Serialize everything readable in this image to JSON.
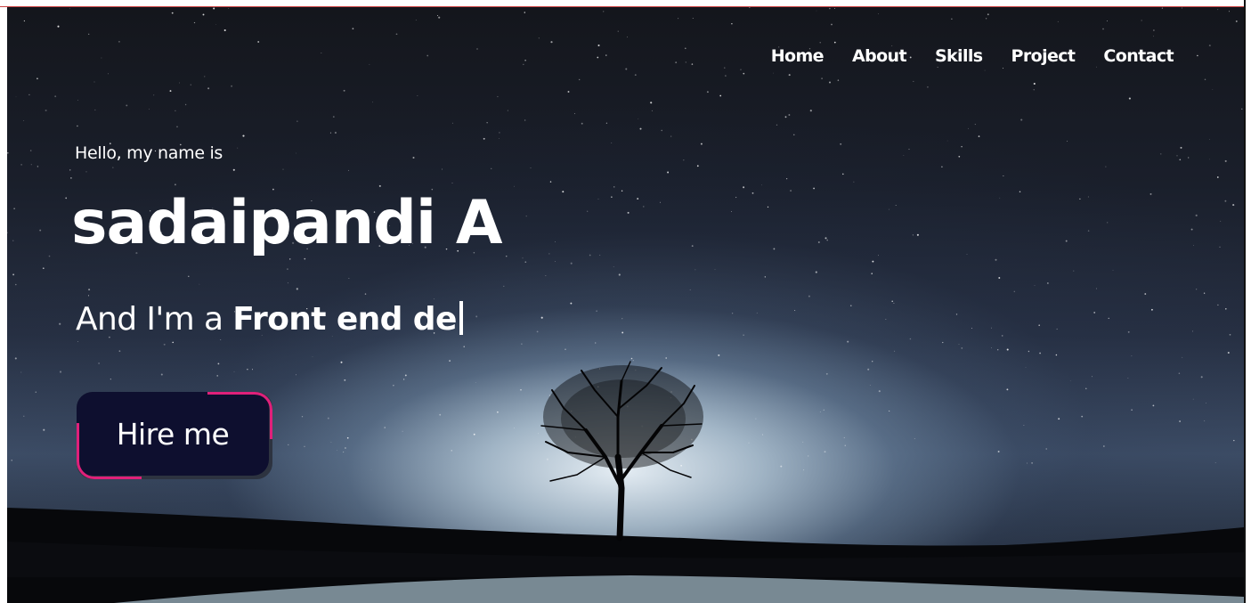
{
  "nav": {
    "items": [
      {
        "label": "Home"
      },
      {
        "label": "About"
      },
      {
        "label": "Skills"
      },
      {
        "label": "Project"
      },
      {
        "label": "Contact"
      }
    ]
  },
  "hero": {
    "greeting": "Hello, my name is",
    "name": "sadaipandi A",
    "role_prefix": "And I'm a ",
    "role_typed": "Front end de",
    "cta_label": "Hire me"
  },
  "colors": {
    "accent": "#e0207a",
    "button_bg": "#0e0f2f",
    "text": "#ffffff"
  }
}
